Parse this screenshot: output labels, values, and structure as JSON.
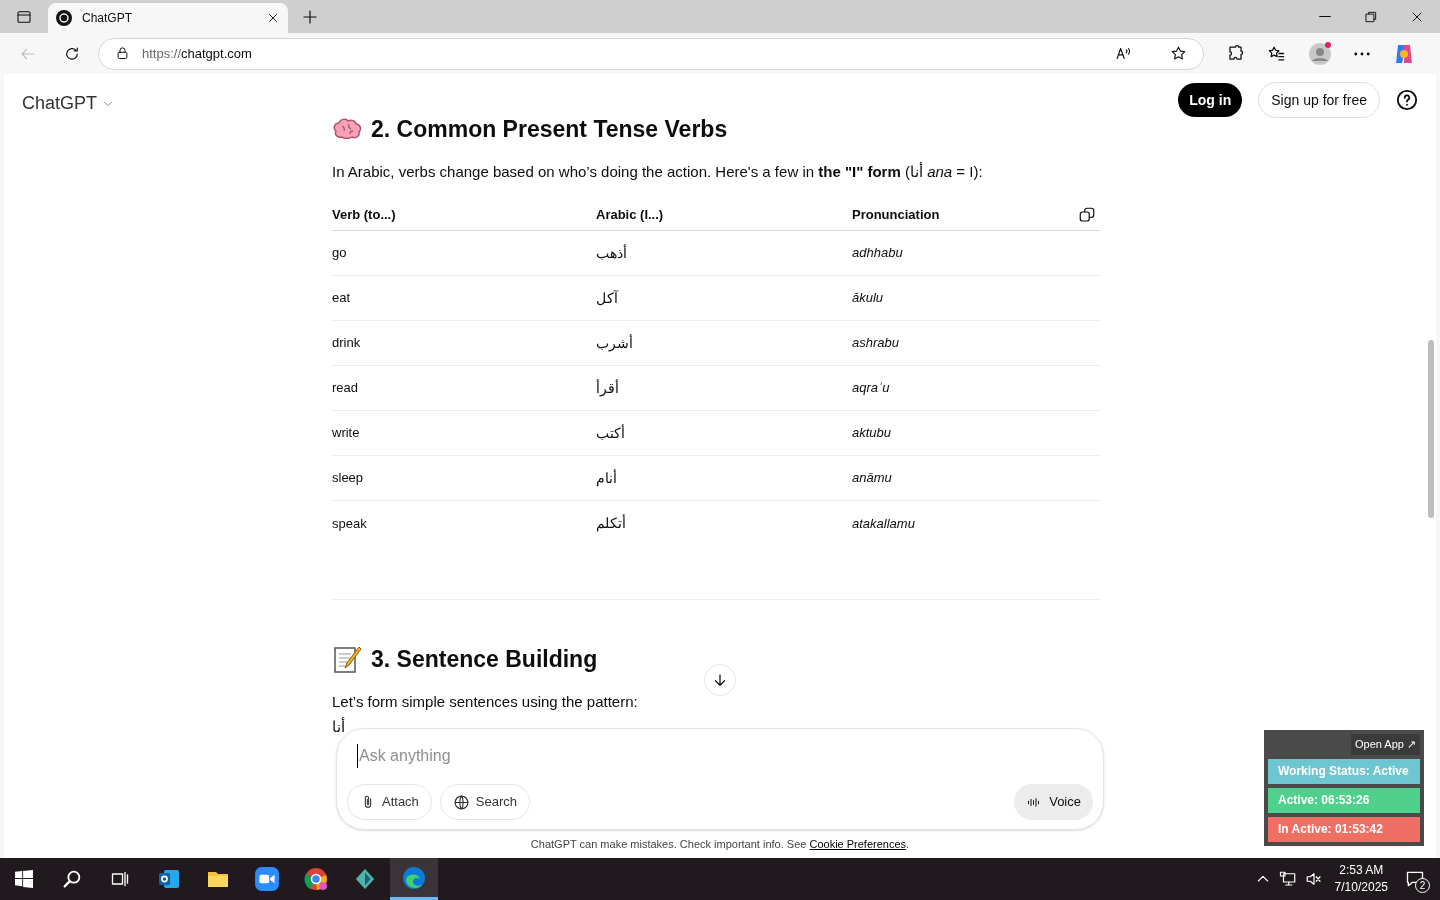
{
  "browser": {
    "tab_title": "ChatGPT",
    "url_scheme": "https://",
    "url_host": "chatgpt.com"
  },
  "header": {
    "model": "ChatGPT",
    "login": "Log in",
    "signup": "Sign up for free"
  },
  "section_2": {
    "heading": "2. Common Present Tense Verbs",
    "intro": "In Arabic, verbs change based on who’s doing the action. Here's a few in **the \"I\" form** (أنا *ana* = I):",
    "table": {
      "columns": [
        "Verb (to...)",
        "Arabic (I...)",
        "Pronunciation"
      ],
      "rows": [
        {
          "verb": "go",
          "arabic": "أذهب",
          "pronunciation": "adhhabu"
        },
        {
          "verb": "eat",
          "arabic": "آكل",
          "pronunciation": "ākulu"
        },
        {
          "verb": "drink",
          "arabic": "أشرب",
          "pronunciation": "ashrabu"
        },
        {
          "verb": "read",
          "arabic": "أقرأ",
          "pronunciation": "aqraʾu"
        },
        {
          "verb": "write",
          "arabic": "أكتب",
          "pronunciation": "aktubu"
        },
        {
          "verb": "sleep",
          "arabic": "أنام",
          "pronunciation": "anāmu"
        },
        {
          "verb": "speak",
          "arabic": "أتكلم",
          "pronunciation": "atakallamu"
        }
      ]
    }
  },
  "section_3": {
    "heading": "3. Sentence Building",
    "intro": "Let’s form simple sentences using the pattern:",
    "partial_line": "أنا"
  },
  "composer": {
    "placeholder": "Ask anything",
    "buttons": [
      {
        "kind": "attach",
        "label": "Attach"
      },
      {
        "kind": "search",
        "label": "Search"
      }
    ],
    "voice": "Voice"
  },
  "footer": {
    "text": "ChatGPT can make mistakes. Check important info. See ",
    "link": "Cookie Preferences",
    "end": "."
  },
  "widget": {
    "open_app": "Open App ↗",
    "statuses": [
      {
        "label": "Working Status: Active",
        "color": "#6ec6d0"
      },
      {
        "label": "Active: 06:53:26",
        "color": "#4fd18b"
      },
      {
        "label": "In Active: 01:53:42",
        "color": "#ef6f64"
      }
    ]
  },
  "taskbar": {
    "time": "2:53 AM",
    "date": "7/10/2025",
    "notifications": "2"
  }
}
